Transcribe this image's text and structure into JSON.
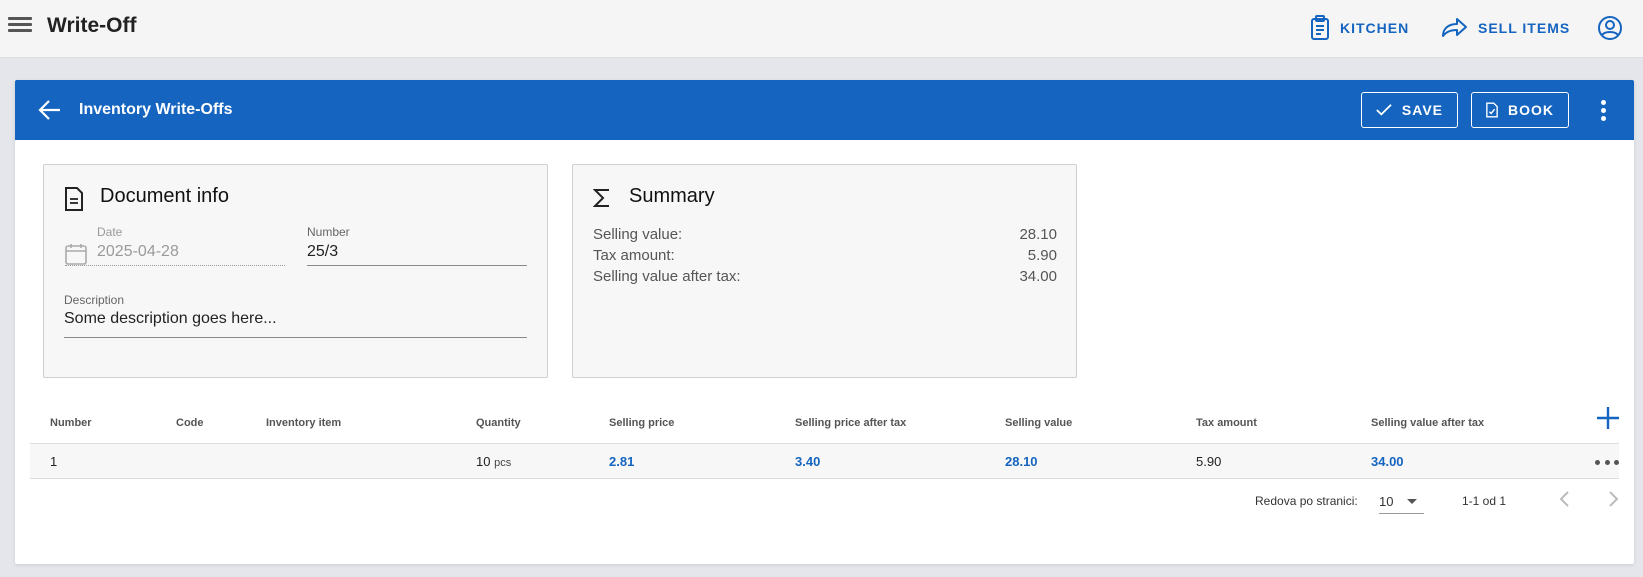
{
  "appbar": {
    "title": "Write-Off",
    "kitchen_label": "KITCHEN",
    "sell_label": "SELL ITEMS"
  },
  "header": {
    "title": "Inventory Write-Offs",
    "save_label": "SAVE",
    "book_label": "BOOK"
  },
  "document_info": {
    "title": "Document info",
    "date_label": "Date",
    "date_value": "2025-04-28",
    "number_label": "Number",
    "number_value": "25/3",
    "description_label": "Description",
    "description_value": "Some description goes here..."
  },
  "summary": {
    "title": "Summary",
    "rows": [
      {
        "label": "Selling value:",
        "value": "28.10"
      },
      {
        "label": "Tax amount:",
        "value": "5.90"
      },
      {
        "label": "Selling value after tax:",
        "value": "34.00"
      }
    ]
  },
  "table": {
    "columns": [
      "Number",
      "Code",
      "Inventory item",
      "Quantity",
      "Selling price",
      "Selling price after tax",
      "Selling value",
      "Tax amount",
      "Selling value after tax"
    ],
    "rows": [
      {
        "number": "1",
        "code": "",
        "item": "",
        "quantity": "10",
        "unit": "pcs",
        "selling_price": "2.81",
        "selling_price_after_tax": "3.40",
        "selling_value": "28.10",
        "tax_amount": "5.90",
        "selling_value_after_tax": "34.00"
      }
    ]
  },
  "pagination": {
    "rows_per_page_label": "Redova po stranici:",
    "rows_per_page_value": "10",
    "range_text": "1-1 od 1"
  },
  "colors": {
    "primary": "#1565c0",
    "appbar_bg": "#f5f5f5",
    "page_bg": "#e4e6ec"
  },
  "icons": [
    "menu-icon",
    "clipboard-icon",
    "share-arrow-icon",
    "account-icon",
    "arrow-left-icon",
    "check-icon",
    "document-check-icon",
    "more-vertical-icon",
    "document-icon",
    "sigma-icon",
    "calendar-icon",
    "plus-icon",
    "more-horizontal-icon",
    "chevron-left-icon",
    "chevron-right-icon"
  ]
}
